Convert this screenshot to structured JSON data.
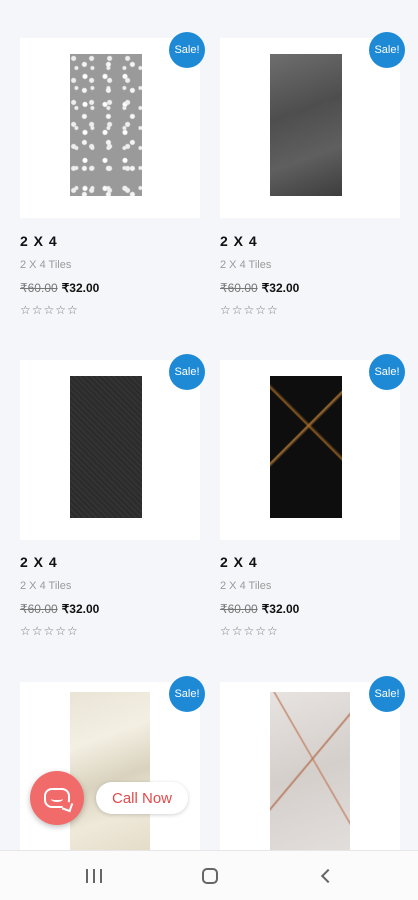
{
  "products": [
    {
      "tile": "terrazzo",
      "title": "2 X 4",
      "category": "2 X 4 Tiles",
      "old_price": "₹60.00",
      "new_price": "₹32.00",
      "badge": "Sale!",
      "rating": "☆☆☆☆☆"
    },
    {
      "tile": "grey-stone",
      "title": "2 X 4",
      "category": "2 X 4 Tiles",
      "old_price": "₹60.00",
      "new_price": "₹32.00",
      "badge": "Sale!",
      "rating": "☆☆☆☆☆"
    },
    {
      "tile": "dark-granite",
      "title": "2 X 4",
      "category": "2 X 4 Tiles",
      "old_price": "₹60.00",
      "new_price": "₹32.00",
      "badge": "Sale!",
      "rating": "☆☆☆☆☆"
    },
    {
      "tile": "black-gold-marble",
      "title": "2 X 4",
      "category": "2 X 4 Tiles",
      "old_price": "₹60.00",
      "new_price": "₹32.00",
      "badge": "Sale!",
      "rating": "☆☆☆☆☆"
    },
    {
      "tile": "cream-marble",
      "badge": "Sale!"
    },
    {
      "tile": "grey-rust-marble",
      "badge": "Sale!"
    }
  ],
  "call_button": {
    "label": "Call Now",
    "icon": "chat-bubble-icon"
  },
  "nav_bar": {
    "recent_icon": "recent-apps-icon",
    "home_icon": "home-icon",
    "back_icon": "back-icon"
  },
  "colors": {
    "sale_badge": "#1e8ad6",
    "call_accent": "#f26b6b",
    "call_text": "#e24a4a"
  }
}
